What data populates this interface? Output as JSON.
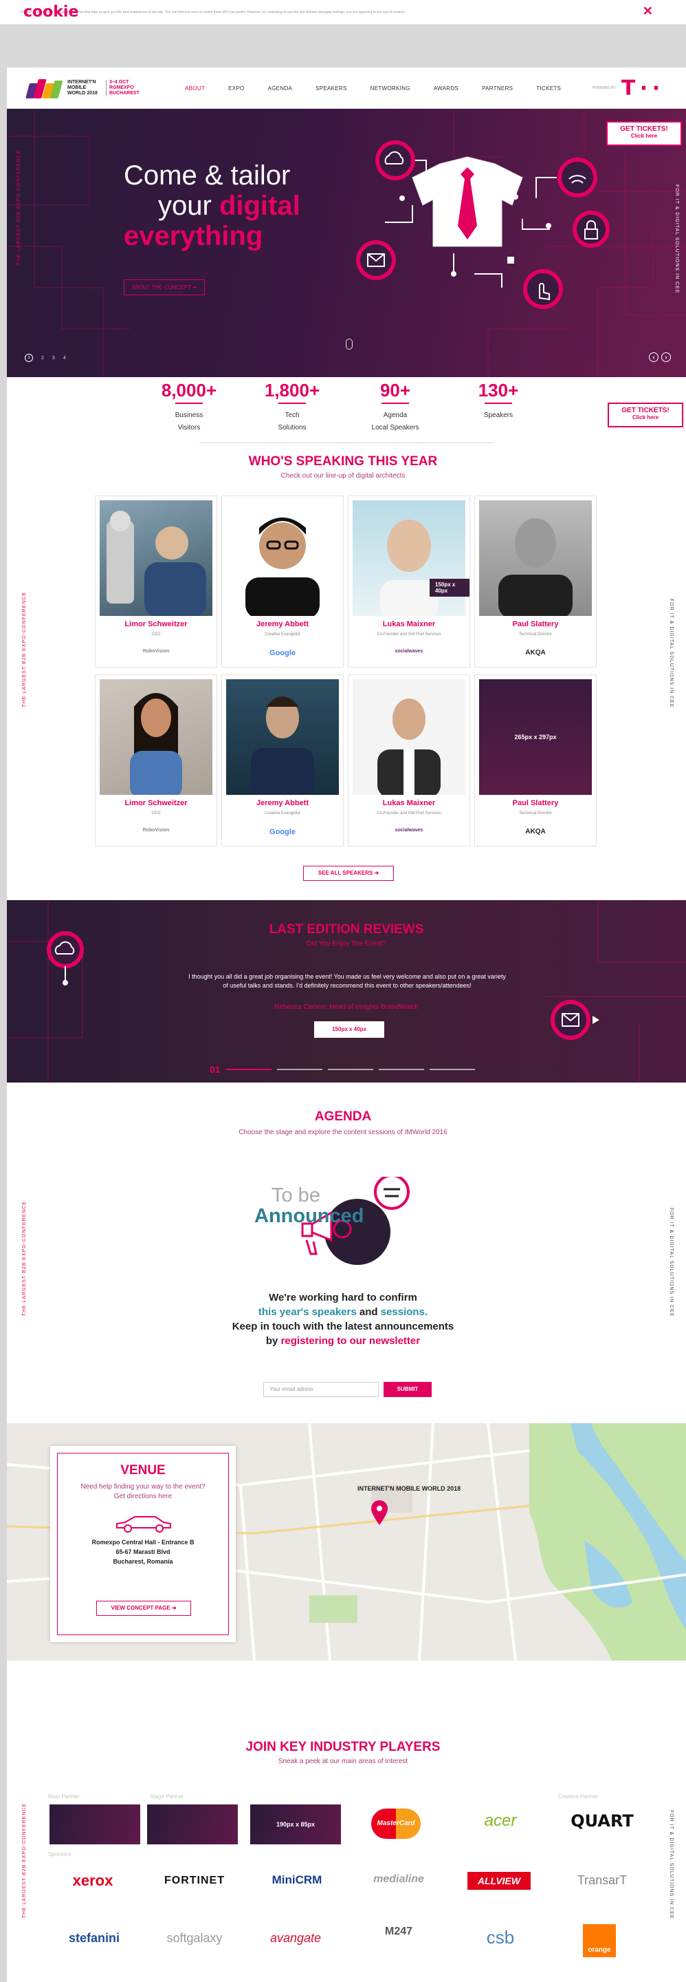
{
  "cookie": {
    "logo": "cookie",
    "text": "We are using cookies to provide statistics that help us give you the best experience of our site. You can find out more or switch them off if you prefer. However, by continuing to use the site without changing settings, you are agreeing to our use of cookies.",
    "close": "✕"
  },
  "header": {
    "brand_line1": "INTERNET'N MOBILE WORLD 2018",
    "brand_line2": "3–4 OCT ROMEXPO BUCHAREST",
    "nav": [
      "ABOUT",
      "EXPO",
      "AGENDA",
      "SPEAKERS",
      "NETWORKING",
      "AWARDS",
      "PARTNERS",
      "TICKETS"
    ],
    "powered_by": "POWERED BY",
    "sponsor_logo": "T · ·"
  },
  "hero": {
    "line1": "Come & tailor",
    "line2a": "your ",
    "line2b": "digital",
    "line3": "everything",
    "cta": "ABOUT THE CONCEPT",
    "tickets": "GET TICKETS!",
    "tickets_sub": "Click here",
    "slides": [
      "1",
      "2",
      "3",
      "4"
    ]
  },
  "side": {
    "left": "THE LARGEST B2B EXPO-CONFERENCE",
    "right": "FOR IT & DIGITAL SOLUTIONS IN CEE"
  },
  "stats": [
    {
      "number": "8,000+",
      "label": "Business\nVisitors"
    },
    {
      "number": "1,800+",
      "label": "Tech\nSolutions"
    },
    {
      "number": "90+",
      "label": "Agenda\nLocal Speakers"
    },
    {
      "number": "130+",
      "label": "Speakers"
    }
  ],
  "speakers_section": {
    "title": "WHO'S SPEAKING THIS YEAR",
    "subtitle": "Check out our line-up of digital architects",
    "see_all": "SEE ALL SPEAKERS",
    "placeholder_small": "150px x 40px",
    "placeholder_large": "265px x 297px",
    "cards": [
      {
        "name": "Limor Schweitzer",
        "role": "CEO",
        "company": "RoboVision"
      },
      {
        "name": "Jeremy Abbett",
        "role": "Creative Evangelist",
        "company": "Google"
      },
      {
        "name": "Lukas Maixner",
        "role": "Co-Founder and GM Prell Services",
        "company": "socialwaves"
      },
      {
        "name": "Paul Slattery",
        "role": "Technical Director",
        "company": "AKQA"
      },
      {
        "name": "Limor Schweitzer",
        "role": "CEO",
        "company": "RoboVision"
      },
      {
        "name": "Jeremy Abbett",
        "role": "Creative Evangelist",
        "company": "Google"
      },
      {
        "name": "Lukas Maixner",
        "role": "Co-Founder and GM Prell Services",
        "company": "socialwaves"
      },
      {
        "name": "Paul Slattery",
        "role": "Technical Director",
        "company": "AKQA"
      }
    ]
  },
  "reviews": {
    "title": "LAST EDITION REVIEWS",
    "subtitle": "Did You Enjoy The Event?",
    "quote": "I thought you all did a great job organising the event! You made us feel very welcome and also put on a great variety of useful talks and stands. I'd definitely recommend this event to other speakers/attendees!",
    "author": "Rebecca Carson, Head of Insights BrandWatch",
    "button": "150px x 40px",
    "page": "01"
  },
  "agenda": {
    "title": "AGENDA",
    "subtitle": "Choose the stage and explore the content sessions of IMWorld 2016",
    "tba1": "To be",
    "tba2": "Announced",
    "msg1": "We're working hard to confirm",
    "msg2a": "this year's speakers",
    "msg2b": " and ",
    "msg2c": "sessions.",
    "msg3": "Keep in touch with the latest announcements",
    "msg4a": "by ",
    "msg4b": "registering to our newsletter",
    "email_placeholder": "Your email adress",
    "submit": "SUBMIT"
  },
  "venue": {
    "title": "VENUE",
    "sub1": "Need help finding your way to the event?",
    "sub2": "Get directions here",
    "addr1": "Romexpo Central Hall - Entrance B",
    "addr2": "65-67 Marasti Blvd",
    "addr3": "Bucharest, Romania",
    "button": "VIEW CONCEPT PAGE"
  },
  "partners": {
    "title": "JOIN KEY INDUSTRY PLAYERS",
    "subtitle": "Sneak a peek at our main areas of interest",
    "main_partner": "Main Partner",
    "stage_partner": "Stage Partner",
    "creative_partner": "Creative Partner",
    "sponsors": "Sponsors",
    "placeholder": "190px x 85px",
    "row1": [
      "MasterCard",
      "acer",
      "QUART"
    ],
    "row2": [
      "xerox",
      "FORTINET",
      "MiniCRM",
      "medialine",
      "ALLVIEW",
      "TransarT"
    ],
    "row3": [
      "stefanini",
      "softgalaxy",
      "avangate",
      "M247",
      "csb",
      "orange"
    ]
  }
}
